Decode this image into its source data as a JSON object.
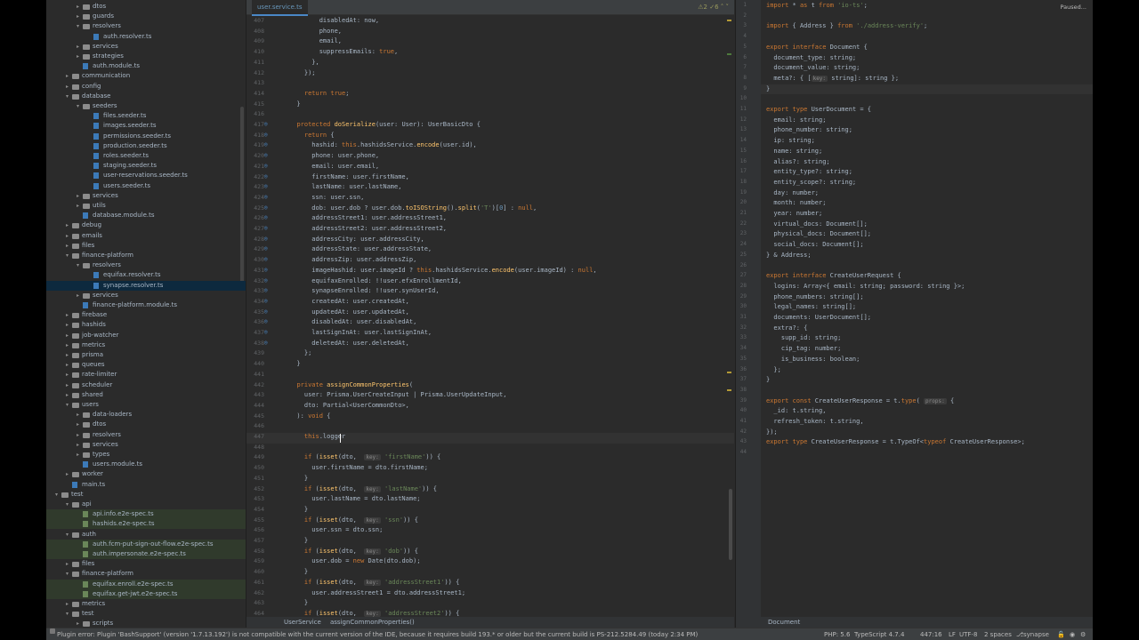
{
  "tree": [
    {
      "depth": 3,
      "kind": "folder",
      "open": false,
      "label": "dtos"
    },
    {
      "depth": 3,
      "kind": "folder",
      "open": false,
      "label": "guards"
    },
    {
      "depth": 3,
      "kind": "folder",
      "open": true,
      "label": "resolvers"
    },
    {
      "depth": 4,
      "kind": "ts",
      "label": "auth.resolver.ts"
    },
    {
      "depth": 3,
      "kind": "folder",
      "open": false,
      "label": "services"
    },
    {
      "depth": 3,
      "kind": "folder",
      "open": false,
      "label": "strategies"
    },
    {
      "depth": 3,
      "kind": "ts",
      "label": "auth.module.ts"
    },
    {
      "depth": 2,
      "kind": "folder",
      "open": false,
      "label": "communication"
    },
    {
      "depth": 2,
      "kind": "folder",
      "open": false,
      "label": "config"
    },
    {
      "depth": 2,
      "kind": "folder",
      "open": true,
      "label": "database"
    },
    {
      "depth": 3,
      "kind": "folder",
      "open": true,
      "label": "seeders"
    },
    {
      "depth": 4,
      "kind": "ts",
      "label": "files.seeder.ts"
    },
    {
      "depth": 4,
      "kind": "ts",
      "label": "images.seeder.ts"
    },
    {
      "depth": 4,
      "kind": "ts",
      "label": "permissions.seeder.ts"
    },
    {
      "depth": 4,
      "kind": "ts",
      "label": "production.seeder.ts"
    },
    {
      "depth": 4,
      "kind": "ts",
      "label": "roles.seeder.ts"
    },
    {
      "depth": 4,
      "kind": "ts",
      "label": "staging.seeder.ts"
    },
    {
      "depth": 4,
      "kind": "ts",
      "label": "user-reservations.seeder.ts"
    },
    {
      "depth": 4,
      "kind": "ts",
      "label": "users.seeder.ts"
    },
    {
      "depth": 3,
      "kind": "folder",
      "open": false,
      "label": "services"
    },
    {
      "depth": 3,
      "kind": "folder",
      "open": false,
      "label": "utils"
    },
    {
      "depth": 3,
      "kind": "ts",
      "label": "database.module.ts"
    },
    {
      "depth": 2,
      "kind": "folder",
      "open": false,
      "label": "debug"
    },
    {
      "depth": 2,
      "kind": "folder",
      "open": false,
      "label": "emails"
    },
    {
      "depth": 2,
      "kind": "folder",
      "open": false,
      "label": "files"
    },
    {
      "depth": 2,
      "kind": "folder",
      "open": true,
      "label": "finance-platform"
    },
    {
      "depth": 3,
      "kind": "folder",
      "open": true,
      "label": "resolvers"
    },
    {
      "depth": 4,
      "kind": "ts",
      "label": "equifax.resolver.ts"
    },
    {
      "depth": 4,
      "kind": "ts",
      "label": "synapse.resolver.ts",
      "selected": true
    },
    {
      "depth": 3,
      "kind": "folder",
      "open": false,
      "label": "services"
    },
    {
      "depth": 3,
      "kind": "ts",
      "label": "finance-platform.module.ts"
    },
    {
      "depth": 2,
      "kind": "folder",
      "open": false,
      "label": "firebase"
    },
    {
      "depth": 2,
      "kind": "folder",
      "open": false,
      "label": "hashids"
    },
    {
      "depth": 2,
      "kind": "folder",
      "open": false,
      "label": "job-watcher"
    },
    {
      "depth": 2,
      "kind": "folder",
      "open": false,
      "label": "metrics"
    },
    {
      "depth": 2,
      "kind": "folder",
      "open": false,
      "label": "prisma"
    },
    {
      "depth": 2,
      "kind": "folder",
      "open": false,
      "label": "queues"
    },
    {
      "depth": 2,
      "kind": "folder",
      "open": false,
      "label": "rate-limiter"
    },
    {
      "depth": 2,
      "kind": "folder",
      "open": false,
      "label": "scheduler"
    },
    {
      "depth": 2,
      "kind": "folder",
      "open": false,
      "label": "shared"
    },
    {
      "depth": 2,
      "kind": "folder",
      "open": true,
      "label": "users"
    },
    {
      "depth": 3,
      "kind": "folder",
      "open": false,
      "label": "data-loaders"
    },
    {
      "depth": 3,
      "kind": "folder",
      "open": false,
      "label": "dtos"
    },
    {
      "depth": 3,
      "kind": "folder",
      "open": false,
      "label": "resolvers"
    },
    {
      "depth": 3,
      "kind": "folder",
      "open": false,
      "label": "services"
    },
    {
      "depth": 3,
      "kind": "folder",
      "open": false,
      "label": "types"
    },
    {
      "depth": 3,
      "kind": "ts",
      "label": "users.module.ts"
    },
    {
      "depth": 2,
      "kind": "folder",
      "open": false,
      "label": "worker"
    },
    {
      "depth": 2,
      "kind": "ts",
      "label": "main.ts"
    },
    {
      "depth": 1,
      "kind": "folder",
      "open": true,
      "label": "test"
    },
    {
      "depth": 2,
      "kind": "folder",
      "open": true,
      "label": "api"
    },
    {
      "depth": 3,
      "kind": "testf",
      "label": "api.info.e2e-spec.ts",
      "test": true
    },
    {
      "depth": 3,
      "kind": "testf",
      "label": "hashids.e2e-spec.ts",
      "test": true
    },
    {
      "depth": 2,
      "kind": "folder",
      "open": true,
      "label": "auth"
    },
    {
      "depth": 3,
      "kind": "testf",
      "label": "auth.fcm-put-sign-out-flow.e2e-spec.ts",
      "test": true
    },
    {
      "depth": 3,
      "kind": "testf",
      "label": "auth.impersonate.e2e-spec.ts",
      "test": true
    },
    {
      "depth": 2,
      "kind": "folder",
      "open": false,
      "label": "files"
    },
    {
      "depth": 2,
      "kind": "folder",
      "open": true,
      "label": "finance-platform"
    },
    {
      "depth": 3,
      "kind": "testf",
      "label": "equifax.enroll.e2e-spec.ts",
      "test": true
    },
    {
      "depth": 3,
      "kind": "testf",
      "label": "equifax.get-jwt.e2e-spec.ts",
      "test": true
    },
    {
      "depth": 2,
      "kind": "folder",
      "open": false,
      "label": "metrics"
    },
    {
      "depth": 2,
      "kind": "folder",
      "open": true,
      "label": "test"
    },
    {
      "depth": 3,
      "kind": "folder",
      "open": false,
      "label": "scripts"
    }
  ],
  "editor": {
    "tab": "user.service.ts",
    "inspection": "⚠2 ✓6 ˄ ˅",
    "first_line": 407,
    "lines": [
      "        disabledAt: now,",
      "        phone,",
      "        email,",
      "        suppressEmails: true,",
      "      },",
      "    });",
      "",
      "    return true;",
      "  }",
      "",
      "  protected doSerialize(user: User): UserBasicDto {",
      "    return {",
      "      hashid: this.hashidsService.encode(user.id),",
      "      phone: user.phone,",
      "      email: user.email,",
      "      firstName: user.firstName,",
      "      lastName: user.lastName,",
      "      ssn: user.ssn,",
      "      dob: user.dob ? user.dob.toISOString().split('T')[0] : null,",
      "      addressStreet1: user.addressStreet1,",
      "      addressStreet2: user.addressStreet2,",
      "      addressCity: user.addressCity,",
      "      addressState: user.addressState,",
      "      addressZip: user.addressZip,",
      "      imageHashid: user.imageId ? this.hashidsService.encode(user.imageId) : null,",
      "      equifaxEnrolled: !!user.efxEnrollmentId,",
      "      synapseEnrolled: !!user.synUserId,",
      "      createdAt: user.createdAt,",
      "      updatedAt: user.updatedAt,",
      "      disabledAt: user.disabledAt,",
      "      lastSignInAt: user.lastSignInAt,",
      "      deletedAt: user.deletedAt,",
      "    };",
      "  }",
      "",
      "  private assignCommonProperties(",
      "    user: Prisma.UserCreateInput | Prisma.UserUpdateInput,",
      "    dto: Partial<UserCommonDto>,",
      "  ): void {",
      "",
      "    this.logger",
      "",
      "    if (isset(dto,  key: 'firstName')) {",
      "      user.firstName = dto.firstName;",
      "    }",
      "    if (isset(dto,  key: 'lastName')) {",
      "      user.lastName = dto.lastName;",
      "    }",
      "    if (isset(dto,  key: 'ssn')) {",
      "      user.ssn = dto.ssn;",
      "    }",
      "    if (isset(dto,  key: 'dob')) {",
      "      user.dob = new Date(dto.dob);",
      "    }",
      "    if (isset(dto,  key: 'addressStreet1')) {",
      "      user.addressStreet1 = dto.addressStreet1;",
      "    }",
      "    if (isset(dto,  key: 'addressStreet2')) {"
    ],
    "breadcrumb": [
      "UserService",
      "assignCommonProperties()"
    ]
  },
  "right": {
    "paused": "Paused...",
    "lines": [
      "import * as t from 'io-ts';",
      "",
      "import { Address } from './address-verify';",
      "",
      "export interface Document {",
      "  document_type: string;",
      "  document_value: string;",
      "  meta?: { [key: string]: string };",
      "}",
      "",
      "export type UserDocument = {",
      "  email: string;",
      "  phone_number: string;",
      "  ip: string;",
      "  name: string;",
      "  alias?: string;",
      "  entity_type?: string;",
      "  entity_scope?: string;",
      "  day: number;",
      "  month: number;",
      "  year: number;",
      "  virtual_docs: Document[];",
      "  physical_docs: Document[];",
      "  social_docs: Document[];",
      "} & Address;",
      "",
      "export interface CreateUserRequest {",
      "  logins: Array<{ email: string; password: string }>;",
      "  phone_numbers: string[];",
      "  legal_names: string[];",
      "  documents: UserDocument[];",
      "  extra?: {",
      "    supp_id: string;",
      "    cip_tag: number;",
      "    is_business: boolean;",
      "  };",
      "}",
      "",
      "export const CreateUserResponse = t.type( props: {",
      "  _id: t.string,",
      "  refresh_token: t.string,",
      "});",
      "export type CreateUserResponse = t.TypeOf<typeof CreateUserResponse>;",
      ""
    ],
    "footer": "Document"
  },
  "status": {
    "message": "Plugin error: Plugin 'BashSupport' (version '1.7.13.192') is not compatible with the current version of the IDE, because it requires build 193.* or older but the current build is PS-212.5284.49 (today 2:34 PM)",
    "php": "PHP: 5.6",
    "ts": "TypeScript 4.7.4",
    "position": "447:16",
    "eol": "LF",
    "encoding": "UTF-8",
    "indent": "2 spaces",
    "branch": "synapse"
  },
  "colors": {
    "bg": "#2b2b2b",
    "keyword": "#cc7832",
    "function": "#ffc66d",
    "string": "#6a8759",
    "property": "#9876aa",
    "selection": "#0d293e"
  }
}
